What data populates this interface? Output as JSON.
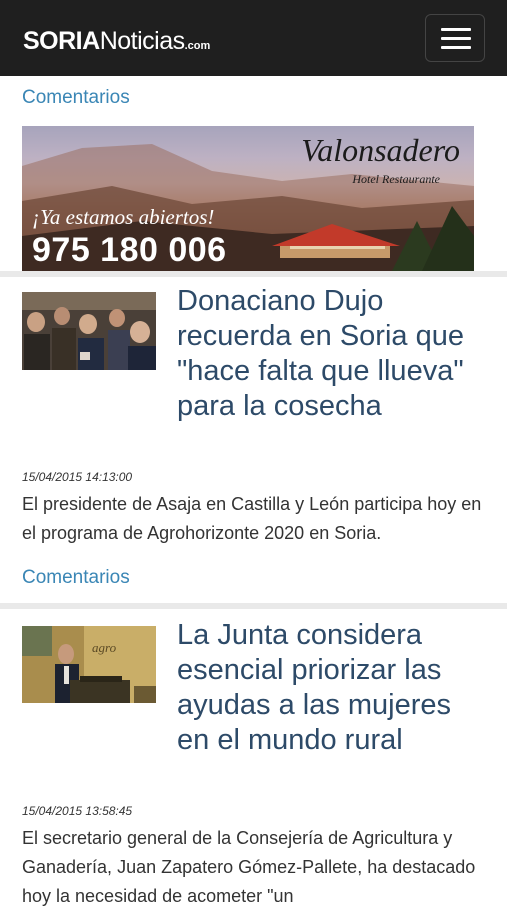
{
  "header": {
    "logo_bold": "SORIA",
    "logo_regular": "Noticias",
    "logo_suffix": ".com",
    "menu_icon": "hamburger-menu-icon"
  },
  "top_comments_label": "Comentarios",
  "ad": {
    "brand": "Valonsadero",
    "subtitle": "Hotel     Restaurante",
    "tagline": "¡Ya estamos abiertos!",
    "phone": "975 180 006"
  },
  "articles": [
    {
      "title": "Donaciano Dujo recuerda en Soria que \"hace falta que llueva\" para la cosecha",
      "date": "15/04/2015 14:13:00",
      "summary": "El presidente de Asaja en Castilla y León participa hoy en el programa de Agrohorizonte 2020 en Soria.",
      "comments_label": "Comentarios"
    },
    {
      "title": "La Junta considera esencial priorizar las ayudas a las mujeres en el mundo rural",
      "date": "15/04/2015 13:58:45",
      "summary": "El secretario general de la Consejería de Agricultura y Ganadería, Juan Zapatero Gómez-Pallete, ha destacado hoy la necesidad de acometer \"un"
    }
  ],
  "colors": {
    "header_bg": "#1f1f1f",
    "link": "#3a86b5",
    "title": "#2d4a68",
    "separator": "#e9e9e9"
  }
}
